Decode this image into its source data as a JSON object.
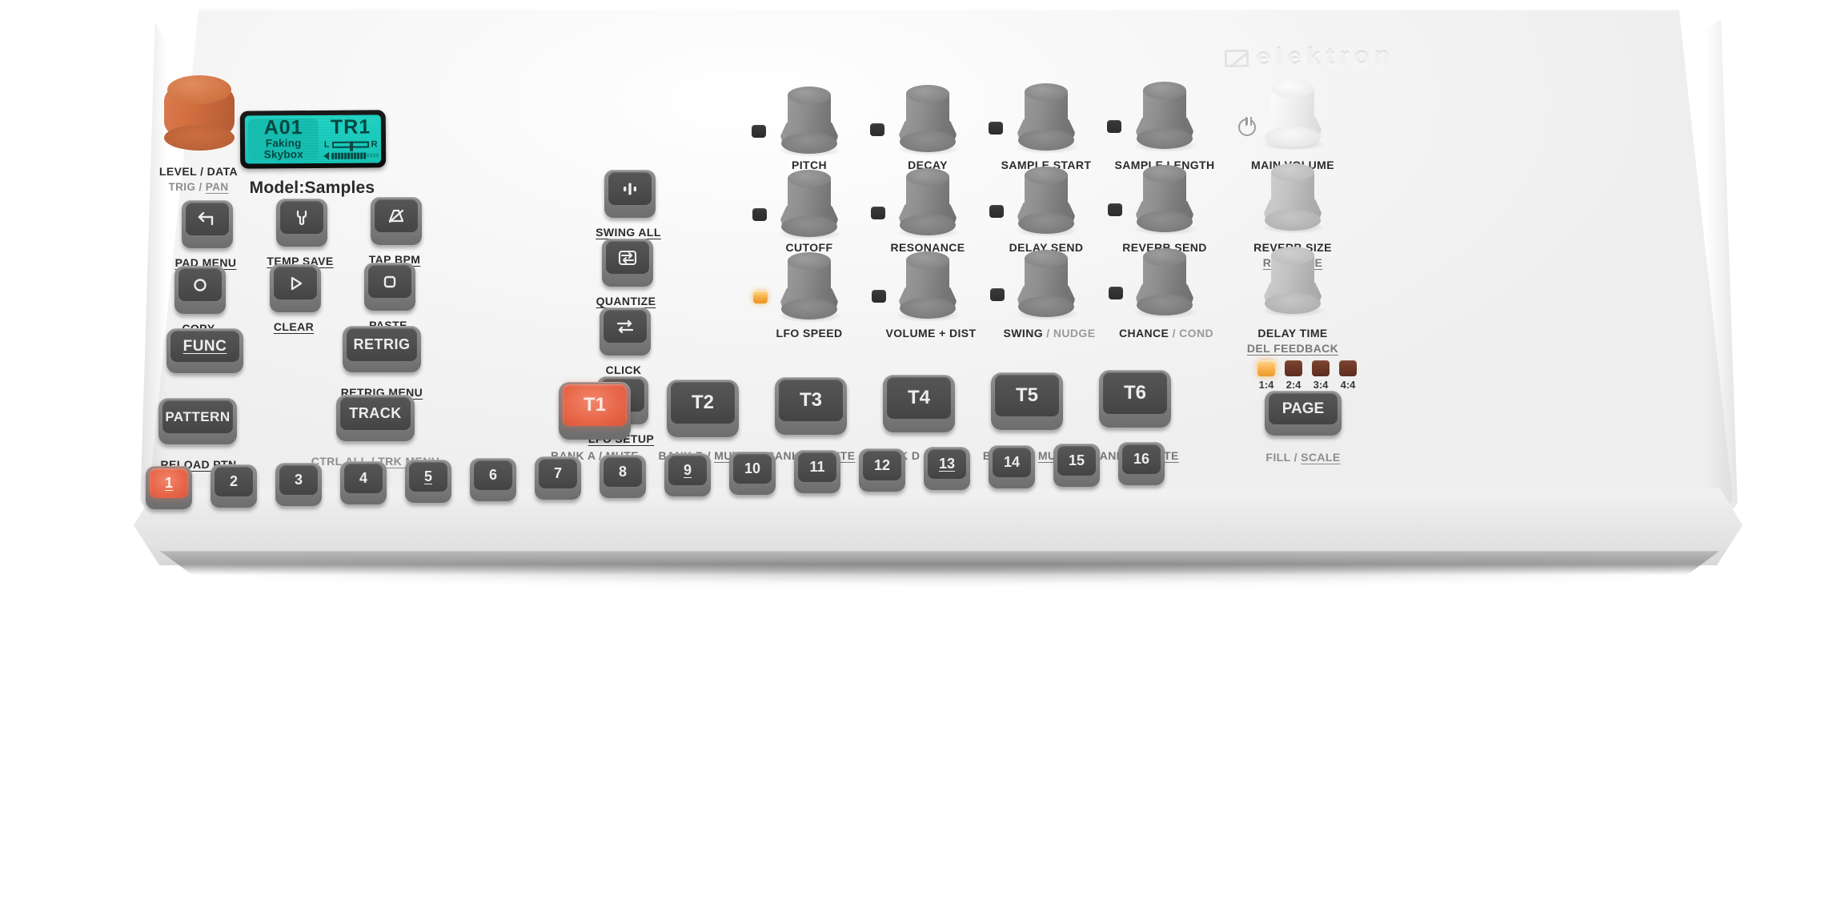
{
  "brand": {
    "logo_text": "elektron",
    "model_name": "Model:Samples"
  },
  "display": {
    "pattern": "A01",
    "sample_line1": "Faking",
    "sample_line2": "Skybox",
    "track": "TR1",
    "pan_left_label": "L",
    "pan_right_label": "R"
  },
  "data_encoder": {
    "primary_label": "LEVEL / DATA",
    "secondary_label_a": "TRIG",
    "secondary_sep": " / ",
    "secondary_label_b": "PAN",
    "color": "#d4703f"
  },
  "function_buttons": [
    {
      "icon": "back-arrow-icon",
      "label": "PAD MENU"
    },
    {
      "icon": "wrench-icon",
      "label": "TEMP SAVE"
    },
    {
      "icon": "metronome-icon",
      "label": "TAP BPM"
    },
    {
      "icon": "record-circle-icon",
      "label": "COPY"
    },
    {
      "icon": "play-triangle-icon",
      "label": "CLEAR"
    },
    {
      "icon": "stop-square-icon",
      "label": "PASTE"
    }
  ],
  "mode_buttons": [
    {
      "text": "FUNC",
      "label": ""
    },
    {
      "text": "PATTERN",
      "label": "RELOAD PTN"
    },
    {
      "text": "RETRIG",
      "label": "RETRIG MENU"
    },
    {
      "text": "TRACK",
      "label": "CTRL ALL / TRK MENU",
      "label_a": "CTRL ALL",
      "label_sep": " / ",
      "label_b": "TRK MENU"
    }
  ],
  "utility_buttons": [
    {
      "icon": "levels-icon",
      "label": "SWING ALL"
    },
    {
      "icon": "loop-icon",
      "label": "QUANTIZE"
    },
    {
      "icon": "exchange-icon",
      "label": "CLICK"
    },
    {
      "icon": "wave-icon",
      "label": "LFO SETUP"
    }
  ],
  "knobs": [
    {
      "label": "PITCH",
      "sub": "",
      "led": "off",
      "style": "grey"
    },
    {
      "label": "DECAY",
      "sub": "",
      "led": "off",
      "style": "grey"
    },
    {
      "label": "SAMPLE START",
      "sub": "",
      "led": "off",
      "style": "grey"
    },
    {
      "label": "SAMPLE LENGTH",
      "sub": "",
      "led": "off",
      "style": "grey"
    },
    {
      "label": "MAIN VOLUME",
      "sub": "",
      "led": "none",
      "style": "white"
    },
    {
      "label": "CUTOFF",
      "sub": "",
      "led": "off",
      "style": "grey"
    },
    {
      "label": "RESONANCE",
      "sub": "",
      "led": "off",
      "style": "grey"
    },
    {
      "label": "DELAY SEND",
      "sub": "",
      "led": "off",
      "style": "grey"
    },
    {
      "label": "REVERB SEND",
      "sub": "",
      "led": "off",
      "style": "grey"
    },
    {
      "label": "REVERB SIZE",
      "sub": "REV TONE",
      "led": "none",
      "style": "lightgrey"
    },
    {
      "label": "LFO SPEED",
      "sub": "",
      "led": "on",
      "style": "grey"
    },
    {
      "label": "VOLUME + DIST",
      "sub": "",
      "led": "off",
      "style": "grey"
    },
    {
      "label": "SWING",
      "sub": "",
      "led": "off",
      "style": "grey",
      "alt": "NUDGE"
    },
    {
      "label": "CHANCE",
      "sub": "",
      "led": "off",
      "style": "grey",
      "alt": "COND"
    },
    {
      "label": "DELAY TIME",
      "sub": "DEL FEEDBACK",
      "led": "none",
      "style": "lightgrey"
    }
  ],
  "tracks": [
    {
      "text": "T1",
      "bank": "BANK A",
      "mute": "MUTE",
      "lit": true
    },
    {
      "text": "T2",
      "bank": "BANK B",
      "mute": "MUTE",
      "lit": false
    },
    {
      "text": "T3",
      "bank": "BANK C",
      "mute": "MUTE",
      "lit": false
    },
    {
      "text": "T4",
      "bank": "BANK D",
      "mute": "MUTE",
      "lit": false
    },
    {
      "text": "T5",
      "bank": "BANK E",
      "mute": "MUTE",
      "lit": false
    },
    {
      "text": "T6",
      "bank": "BANK F",
      "mute": "MUTE",
      "lit": false
    }
  ],
  "page_section": {
    "leds": [
      {
        "text": "1:4",
        "on": true
      },
      {
        "text": "2:4",
        "on": false
      },
      {
        "text": "3:4",
        "on": false
      },
      {
        "text": "4:4",
        "on": false
      }
    ],
    "button_text": "PAGE",
    "label_a": "FILL",
    "label_sep": " / ",
    "label_b": "SCALE"
  },
  "steps": [
    {
      "text": "1",
      "lit": true,
      "accent": true
    },
    {
      "text": "2",
      "lit": false,
      "accent": false
    },
    {
      "text": "3",
      "lit": false,
      "accent": false
    },
    {
      "text": "4",
      "lit": false,
      "accent": false
    },
    {
      "text": "5",
      "lit": false,
      "accent": true
    },
    {
      "text": "6",
      "lit": false,
      "accent": false
    },
    {
      "text": "7",
      "lit": false,
      "accent": false
    },
    {
      "text": "8",
      "lit": false,
      "accent": false
    },
    {
      "text": "9",
      "lit": false,
      "accent": true
    },
    {
      "text": "10",
      "lit": false,
      "accent": false
    },
    {
      "text": "11",
      "lit": false,
      "accent": false
    },
    {
      "text": "12",
      "lit": false,
      "accent": false
    },
    {
      "text": "13",
      "lit": false,
      "accent": true
    },
    {
      "text": "14",
      "lit": false,
      "accent": false
    },
    {
      "text": "15",
      "lit": false,
      "accent": false
    },
    {
      "text": "16",
      "lit": false,
      "accent": false
    }
  ]
}
